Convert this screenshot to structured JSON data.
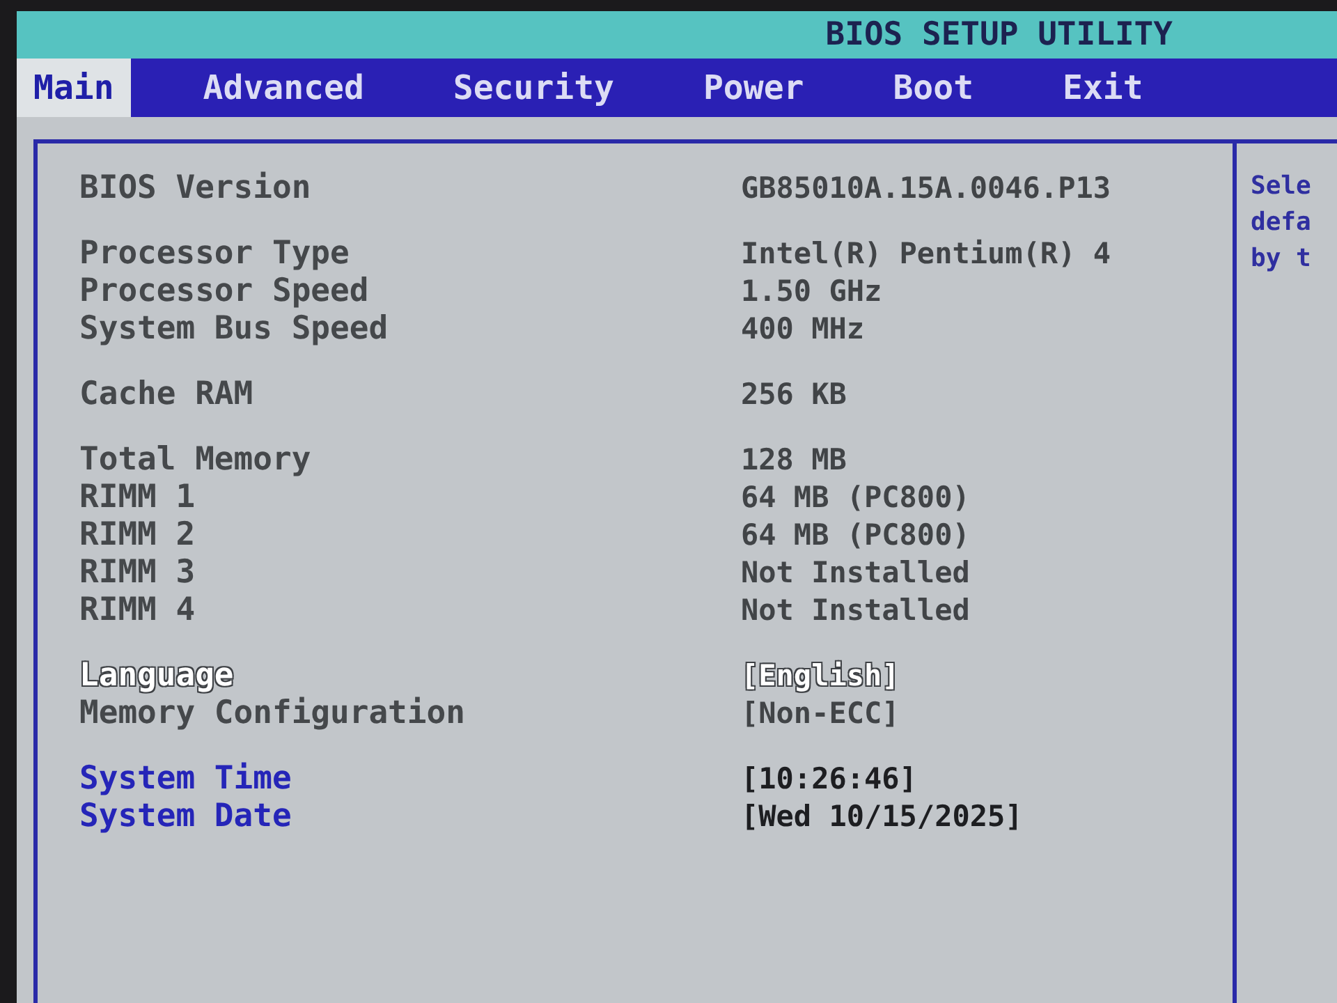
{
  "title": "BIOS SETUP UTILITY",
  "tabs": [
    {
      "label": "Main",
      "selected": true
    },
    {
      "label": "Advanced",
      "selected": false
    },
    {
      "label": "Security",
      "selected": false
    },
    {
      "label": "Power",
      "selected": false
    },
    {
      "label": "Boot",
      "selected": false
    },
    {
      "label": "Exit",
      "selected": false
    }
  ],
  "sections": [
    {
      "items": [
        {
          "kind": "info",
          "label": "BIOS Version",
          "value": "GB85010A.15A.0046.P13",
          "selected": false
        }
      ]
    },
    {
      "items": [
        {
          "kind": "info",
          "label": "Processor Type",
          "value": "Intel(R) Pentium(R) 4",
          "selected": false
        },
        {
          "kind": "info",
          "label": "Processor Speed",
          "value": "1.50 GHz",
          "selected": false
        },
        {
          "kind": "info",
          "label": "System Bus Speed",
          "value": "400 MHz",
          "selected": false
        }
      ]
    },
    {
      "items": [
        {
          "kind": "info",
          "label": "Cache RAM",
          "value": "256 KB",
          "selected": false
        }
      ]
    },
    {
      "items": [
        {
          "kind": "info",
          "label": "Total Memory",
          "value": "128 MB",
          "selected": false
        },
        {
          "kind": "info",
          "label": "RIMM 1",
          "value": "64 MB (PC800)",
          "selected": false
        },
        {
          "kind": "info",
          "label": "RIMM 2",
          "value": "64 MB (PC800)",
          "selected": false
        },
        {
          "kind": "info",
          "label": "RIMM 3",
          "value": "Not Installed",
          "selected": false
        },
        {
          "kind": "info",
          "label": "RIMM 4",
          "value": "Not Installed",
          "selected": false
        }
      ]
    },
    {
      "items": [
        {
          "kind": "option",
          "label": "Language",
          "value": "[English]",
          "selected": true
        },
        {
          "kind": "info",
          "label": "Memory Configuration",
          "value": "[Non-ECC]",
          "selected": false
        }
      ]
    },
    {
      "items": [
        {
          "kind": "option",
          "label": "System Time",
          "value": "[10:26:46]",
          "selected": false
        },
        {
          "kind": "option",
          "label": "System Date",
          "value": "[Wed 10/15/2025]",
          "selected": false
        }
      ]
    }
  ],
  "help": {
    "lines": [
      "Sele",
      "defa",
      "by t"
    ]
  }
}
